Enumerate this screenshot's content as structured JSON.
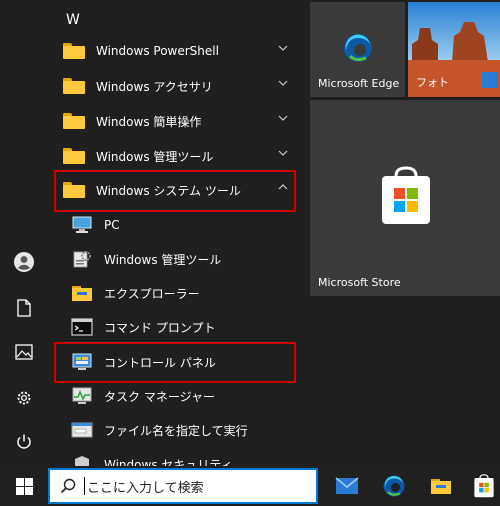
{
  "section_letter": "W",
  "apps": [
    {
      "label": "Windows PowerShell",
      "icon": "folder-icon",
      "expandable": true
    },
    {
      "label": "Windows アクセサリ",
      "icon": "folder-icon",
      "expandable": true
    },
    {
      "label": "Windows 簡単操作",
      "icon": "folder-icon",
      "expandable": true
    },
    {
      "label": "Windows 管理ツール",
      "icon": "folder-icon",
      "expandable": true
    },
    {
      "label": "Windows システム ツール",
      "icon": "folder-icon",
      "expanded": true
    }
  ],
  "subitems": [
    {
      "label": "PC",
      "icon": "pc-icon"
    },
    {
      "label": "Windows 管理ツール",
      "icon": "admin-tools-icon"
    },
    {
      "label": "エクスプローラー",
      "icon": "file-explorer-icon"
    },
    {
      "label": "コマンド プロンプト",
      "icon": "command-prompt-icon"
    },
    {
      "label": "コントロール パネル",
      "icon": "control-panel-icon"
    },
    {
      "label": "タスク マネージャー",
      "icon": "task-manager-icon"
    },
    {
      "label": "ファイル名を指定して実行",
      "icon": "run-icon"
    },
    {
      "label": "Windows セキュリティ",
      "icon": "shield-icon"
    }
  ],
  "tiles": {
    "edge": "Microsoft Edge",
    "photos": "フォト",
    "store": "Microsoft Store"
  },
  "search": {
    "placeholder": "ここに入力して検索"
  },
  "rail_icons": [
    "user-icon",
    "document-icon",
    "pictures-icon",
    "settings-icon",
    "power-icon"
  ],
  "taskbar_apps": [
    "mail-icon",
    "edge-icon",
    "file-explorer-icon",
    "store-icon"
  ],
  "colors": {
    "highlight": "#d10000",
    "accent": "#0078d4",
    "folder": "#ffc83d",
    "background": "#1f1f1f",
    "tile": "#3a3a3a"
  }
}
